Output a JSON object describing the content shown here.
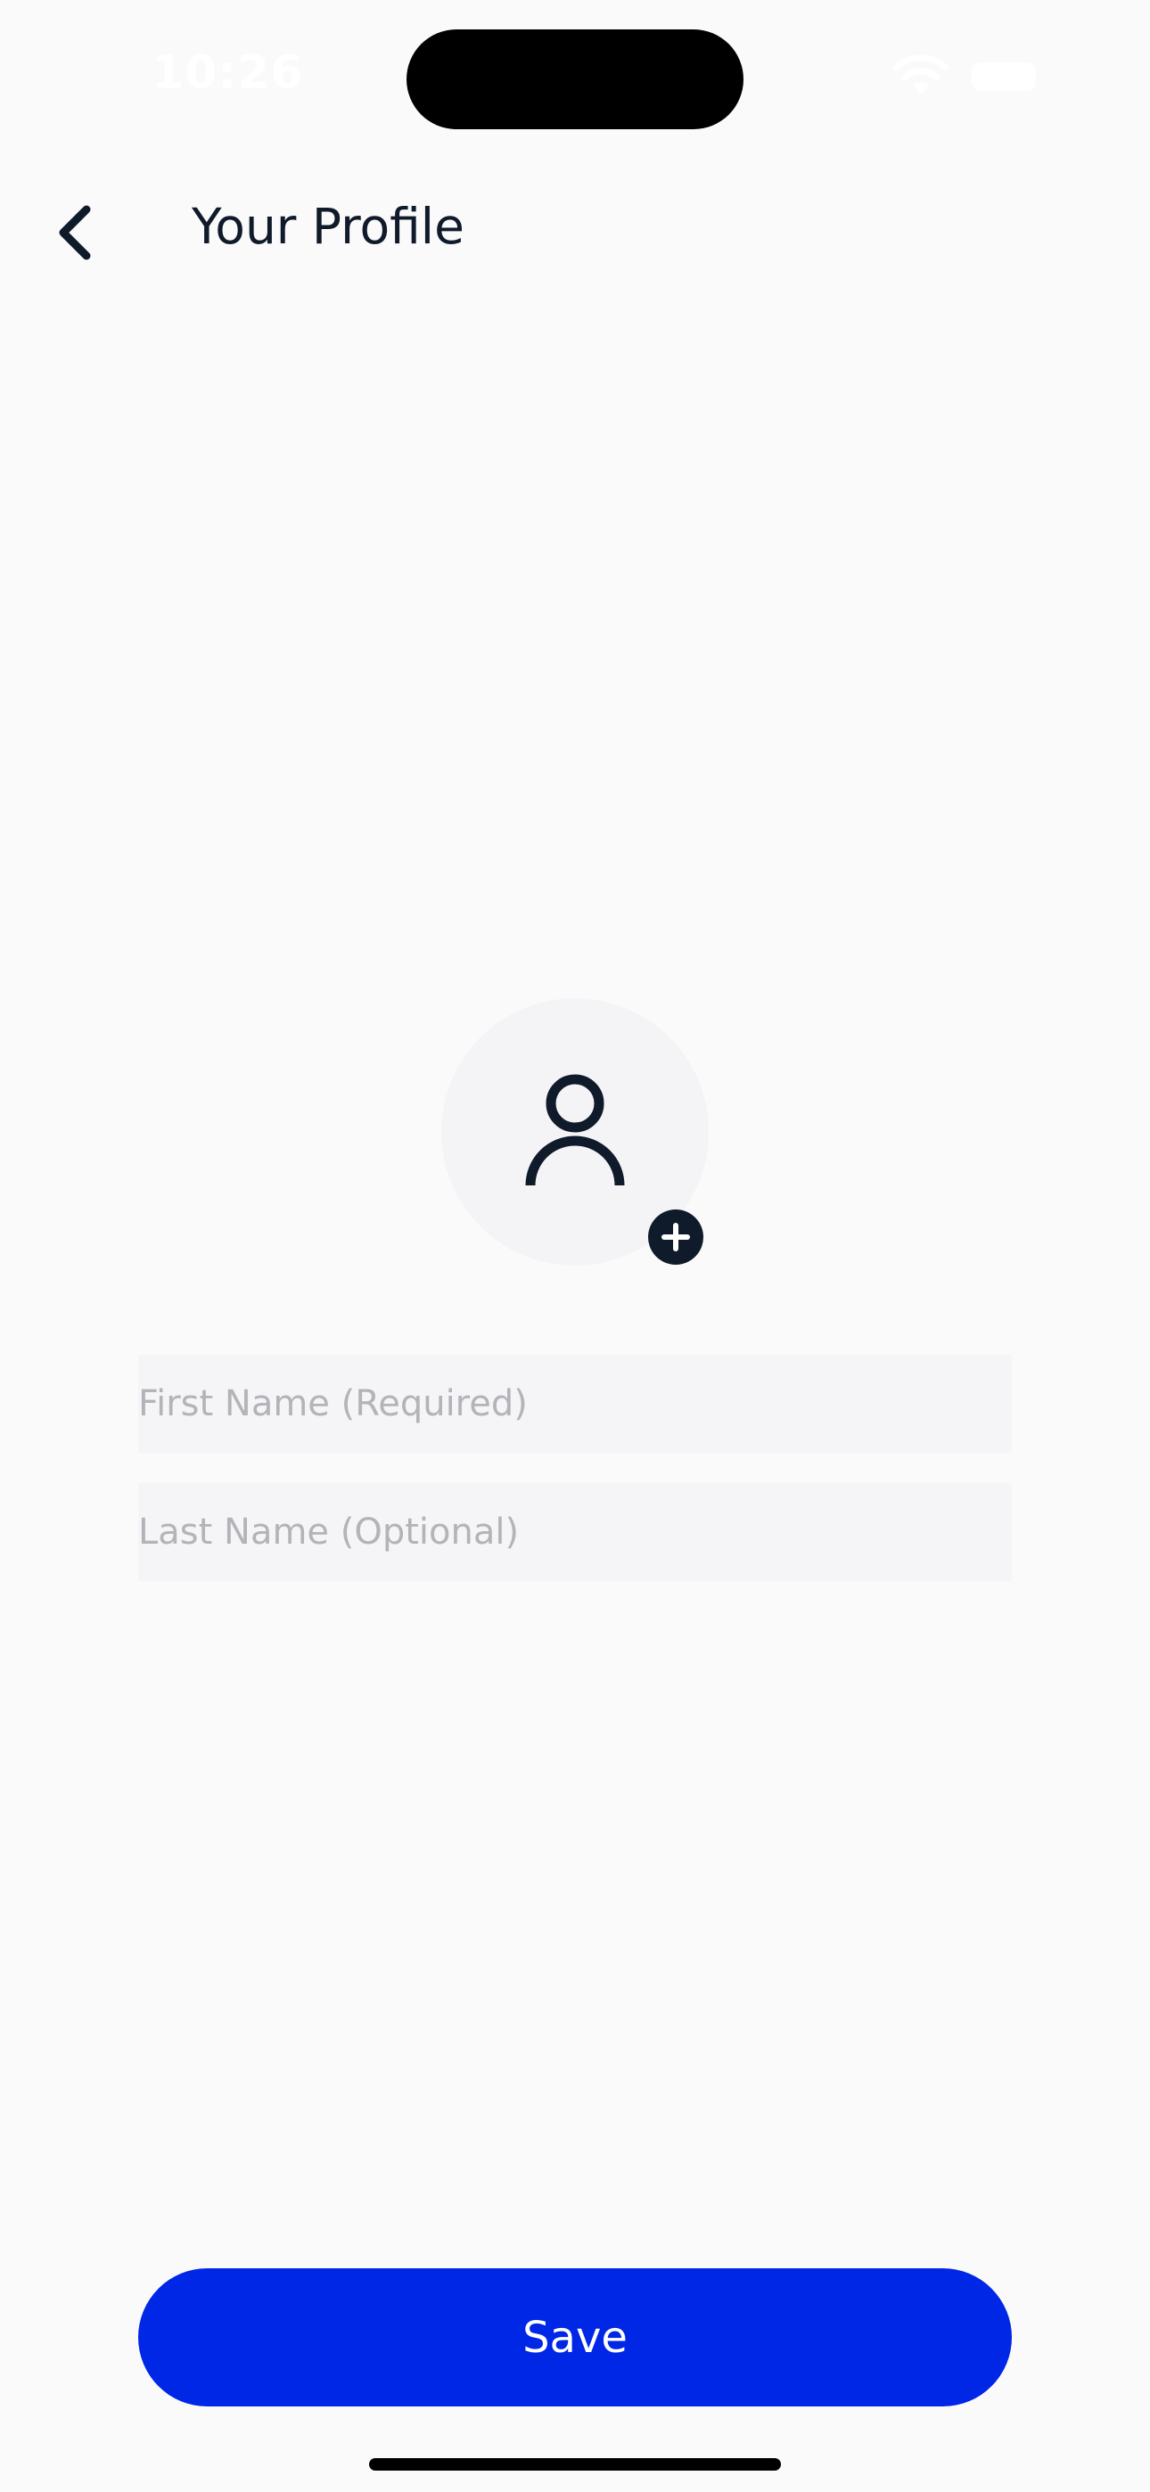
{
  "status_bar": {
    "time": "10:26"
  },
  "header": {
    "title": "Your Profile",
    "back_icon": "chevron-left-icon"
  },
  "avatar": {
    "icon": "person-icon",
    "add_icon": "plus-circle-icon"
  },
  "form": {
    "first_name_placeholder": "First Name (Required)",
    "first_name_value": "",
    "last_name_placeholder": "Last Name (Optional)",
    "last_name_value": ""
  },
  "actions": {
    "save_label": "Save"
  },
  "colors": {
    "primary": "#0026e6",
    "text": "#0f1a2a",
    "background": "#fafafa",
    "field_background": "#f5f5f8",
    "placeholder": "#b3b3b8"
  }
}
